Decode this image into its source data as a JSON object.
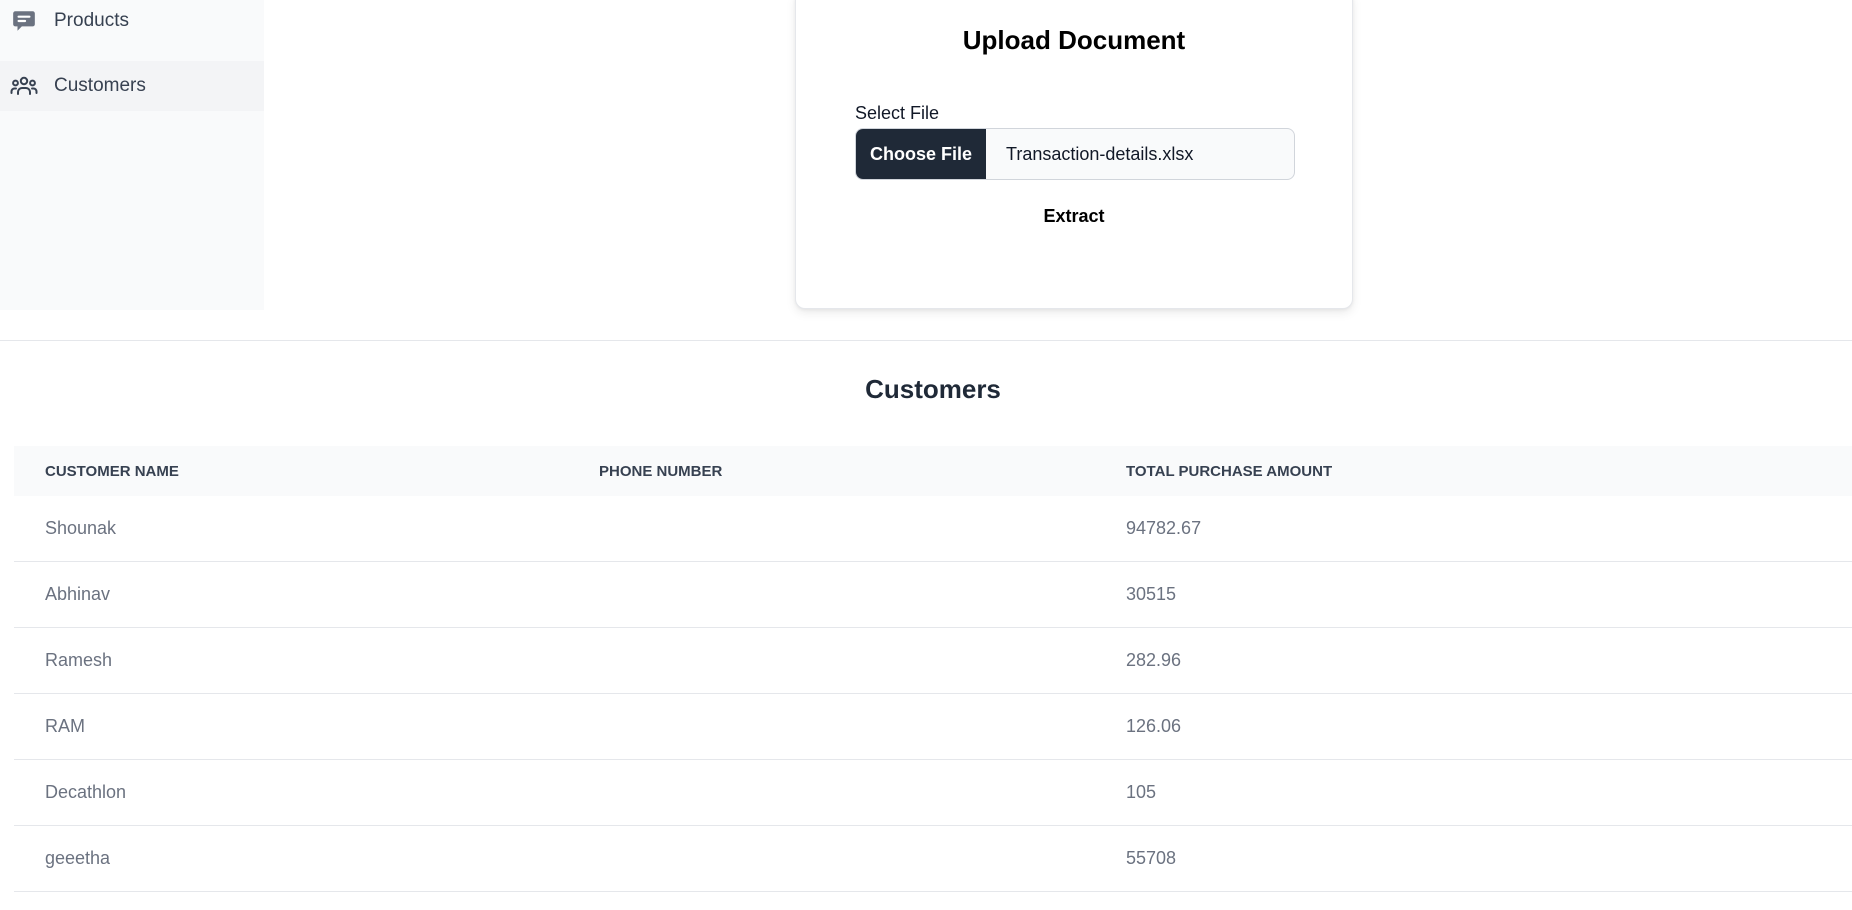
{
  "sidebar": {
    "items": [
      {
        "label": "Products",
        "icon": "chat-bubble-icon"
      },
      {
        "label": "Customers",
        "icon": "users-icon"
      }
    ]
  },
  "upload": {
    "title": "Upload Document",
    "select_label": "Select File",
    "choose_button": "Choose File",
    "file_name": "Transaction-details.xlsx",
    "extract_button": "Extract"
  },
  "customers": {
    "title": "Customers",
    "columns": [
      "CUSTOMER NAME",
      "PHONE NUMBER",
      "TOTAL PURCHASE AMOUNT"
    ],
    "rows": [
      {
        "name": "Shounak",
        "phone": "",
        "total": "94782.67"
      },
      {
        "name": "Abhinav",
        "phone": "",
        "total": "30515"
      },
      {
        "name": "Ramesh",
        "phone": "",
        "total": "282.96"
      },
      {
        "name": "RAM",
        "phone": "",
        "total": "126.06"
      },
      {
        "name": "Decathlon",
        "phone": "",
        "total": "105"
      },
      {
        "name": "geeetha",
        "phone": "",
        "total": "55708"
      }
    ]
  },
  "colors": {
    "sidebar_bg": "#f9fafb",
    "active_item_bg": "#f3f4f6",
    "dark_button": "#1f2937",
    "muted_text": "#6b7280"
  }
}
